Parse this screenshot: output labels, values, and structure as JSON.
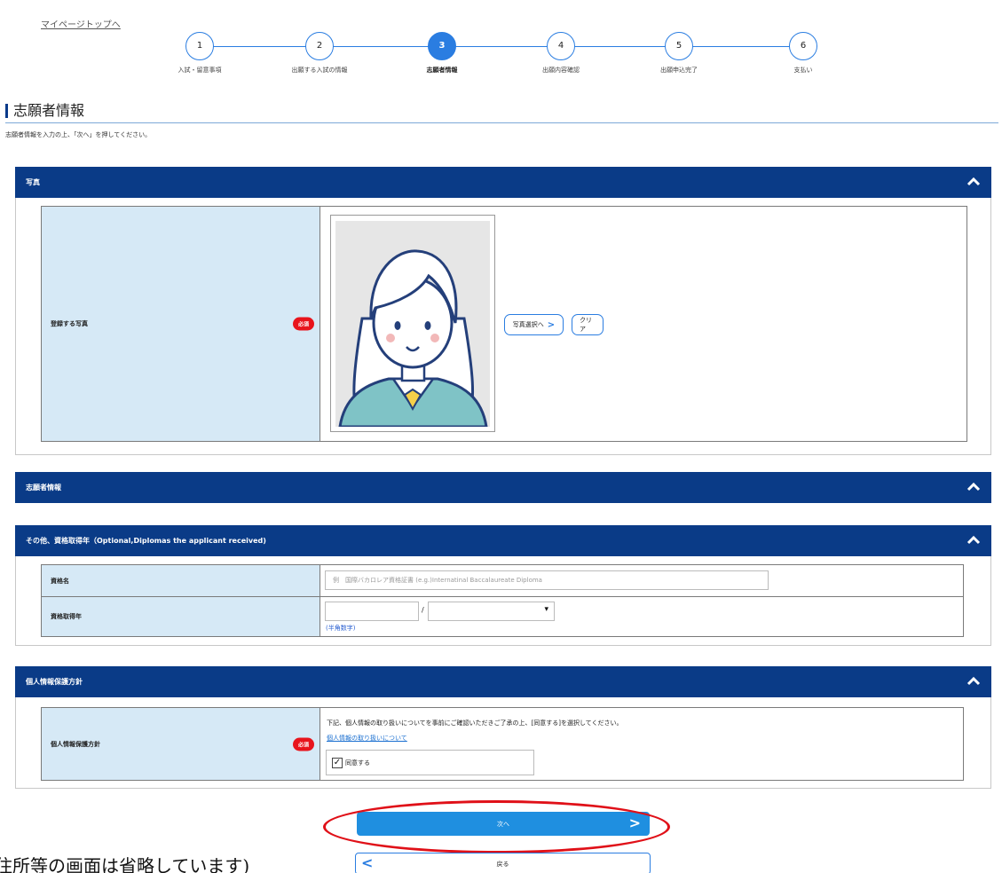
{
  "mypage_link": "マイページトップへ",
  "steps": [
    {
      "num": "1",
      "label": "入試・留意事項"
    },
    {
      "num": "2",
      "label": "出願する入試の情報"
    },
    {
      "num": "3",
      "label": "志願者情報"
    },
    {
      "num": "4",
      "label": "出願内容確認"
    },
    {
      "num": "5",
      "label": "出願申込完了"
    },
    {
      "num": "6",
      "label": "支払い"
    }
  ],
  "active_step": 3,
  "page_title": "志願者情報",
  "intro": "志願者情報を入力の上、「次へ」を押してください。",
  "photo_section": {
    "header": "写真",
    "label": "登録する写真",
    "required": "必須",
    "select_button": "写真選択へ",
    "clear_button": "クリア"
  },
  "applicant_section": {
    "header": "志願者情報"
  },
  "qualification_section": {
    "header": "その他、資格取得年（Optional,Diplomas the applicant received)",
    "name_label": "資格名",
    "name_placeholder": "例　国際バカロレア資格証書 (e.g.)Internatinal Baccalaureate Diploma",
    "year_label": "資格取得年",
    "slash": "/",
    "note": "(半角数字)"
  },
  "privacy_section": {
    "header": "個人情報保護方針",
    "label": "個人情報保護方針",
    "required": "必須",
    "text": "下記、個人情報の取り扱いについてを事前にご確認いただきご了承の上、[同意する]を選択してください。",
    "link": "個人情報の取り扱いについて",
    "agree_label": "同意する",
    "agreed": true
  },
  "next_button": "次へ",
  "back_button": "戻る",
  "bottom_note": "住所等の画面は省略しています)"
}
